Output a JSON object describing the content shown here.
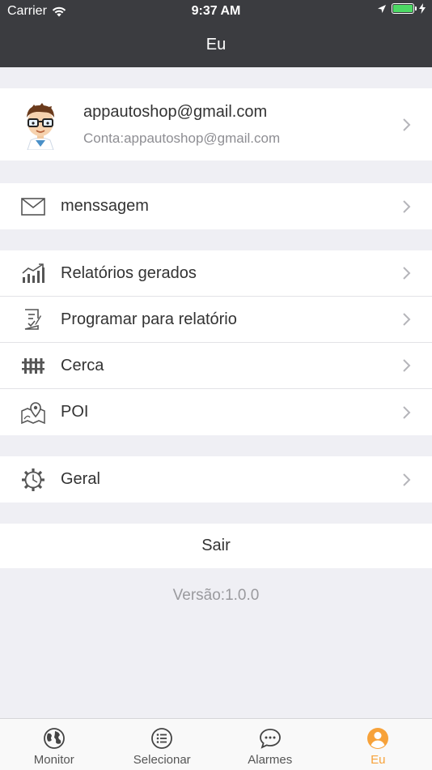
{
  "status_bar": {
    "carrier": "Carrier",
    "time": "9:37 AM"
  },
  "nav": {
    "title": "Eu"
  },
  "profile": {
    "email": "appautoshop@gmail.com",
    "account": "Conta:appautoshop@gmail.com"
  },
  "groups": {
    "messages": [
      {
        "label": "menssagem",
        "icon": "envelope-icon"
      }
    ],
    "reports": [
      {
        "label": "Relatórios gerados",
        "icon": "chart-trend-icon"
      },
      {
        "label": "Programar para relatório",
        "icon": "schedule-report-icon"
      },
      {
        "label": "Cerca",
        "icon": "fence-icon"
      },
      {
        "label": "POI",
        "icon": "map-pin-icon"
      }
    ],
    "settings": [
      {
        "label": "Geral",
        "icon": "gear-icon"
      }
    ]
  },
  "logout_label": "Sair",
  "version": "Versão:1.0.0",
  "tabs": [
    {
      "label": "Monitor",
      "icon": "globe-icon",
      "active": false
    },
    {
      "label": "Selecionar",
      "icon": "list-icon",
      "active": false
    },
    {
      "label": "Alarmes",
      "icon": "chat-bubble-icon",
      "active": false
    },
    {
      "label": "Eu",
      "icon": "user-icon",
      "active": true
    }
  ],
  "colors": {
    "header": "#3b3c40",
    "accent": "#f7a23a",
    "battery": "#4cd964"
  }
}
